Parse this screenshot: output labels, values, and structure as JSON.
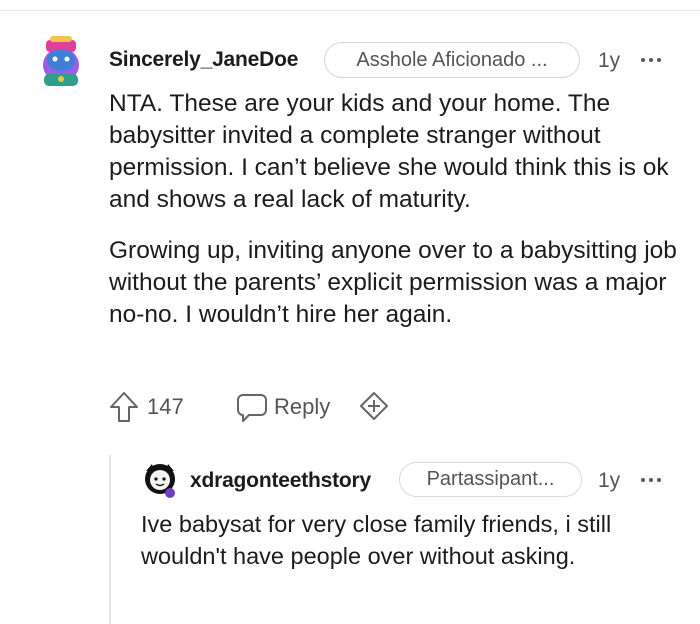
{
  "comment": {
    "username": "Sincerely_JaneDoe",
    "flair": "Asshole Aficionado ...",
    "age": "1y",
    "paragraphs": [
      "NTA. These are your kids and your home. The babysitter invited a complete stranger without permission. I can’t believe she would think this is ok and shows a real lack of maturity.",
      "Growing up, inviting anyone over to a babysitting job without the parents’ explicit permission was a major no-no. I wouldn’t hire her again."
    ],
    "upvotes": "147",
    "reply_label": "Reply"
  },
  "reply": {
    "username": "xdragonteethstory",
    "flair": "Partassipant...",
    "age": "1y",
    "text": "Ive babysat for very close family friends, i still wouldn't have people over without asking."
  },
  "icons": {
    "upvote": "upvote-arrow-icon",
    "reply": "speech-bubble-icon",
    "award": "award-plus-icon",
    "more": "more-horizontal-icon"
  },
  "colors": {
    "text": "#1c1c1c",
    "muted": "#555555",
    "border": "#d8d8d8",
    "avatar1_bg": "#3f7fd8",
    "avatar1_accent": "#9b5de5"
  }
}
